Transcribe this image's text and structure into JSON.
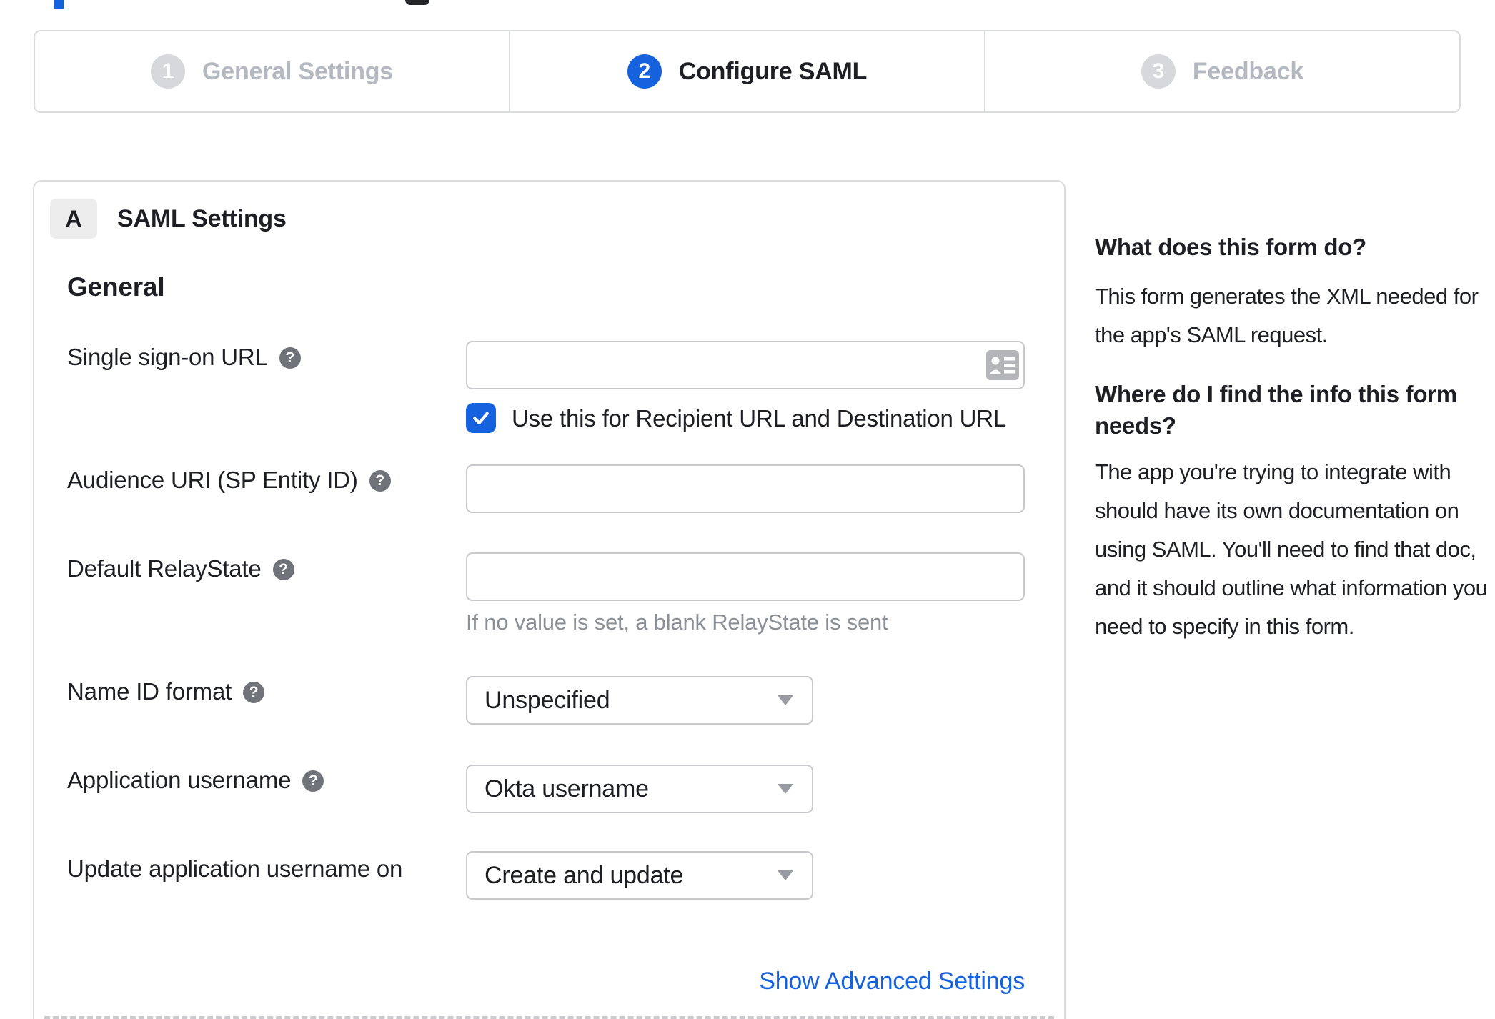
{
  "stepper": {
    "steps": [
      {
        "number": "1",
        "label": "General Settings",
        "state": "inactive"
      },
      {
        "number": "2",
        "label": "Configure SAML",
        "state": "active"
      },
      {
        "number": "3",
        "label": "Feedback",
        "state": "inactive"
      }
    ]
  },
  "panel": {
    "badge": "A",
    "title": "SAML Settings",
    "group_heading": "General",
    "fields": {
      "sso": {
        "label": "Single sign-on URL",
        "value": "",
        "checkbox_label": "Use this for Recipient URL and Destination URL",
        "checkbox_checked": true
      },
      "audience": {
        "label": "Audience URI (SP Entity ID)",
        "value": ""
      },
      "relay": {
        "label": "Default RelayState",
        "value": "",
        "hint": "If no value is set, a blank RelayState is sent"
      },
      "name_id": {
        "label": "Name ID format",
        "value": "Unspecified"
      },
      "app_username": {
        "label": "Application username",
        "value": "Okta username"
      },
      "update_username": {
        "label": "Update application username on",
        "value": "Create and update"
      }
    },
    "advanced_link": "Show Advanced Settings"
  },
  "sidebar": {
    "heading_1": "What does this form do?",
    "para_1": "This form generates the XML needed for the app's SAML request.",
    "heading_2": "Where do I find the info this form needs?",
    "para_2": "The app you're trying to integrate with should have its own documentation on using SAML. You'll need to find that doc, and it should outline what information you need to specify in this form."
  },
  "icons": {
    "help_glyph": "?"
  },
  "colors": {
    "accent_blue": "#1661dd",
    "text_dark": "#1d1f24",
    "step_inactive_text": "#b4b8c0",
    "step_inactive_circle": "#d6d8db",
    "panel_border": "#dadbdd",
    "input_border": "#c8c9cc",
    "hint_text": "#8b8f97"
  }
}
